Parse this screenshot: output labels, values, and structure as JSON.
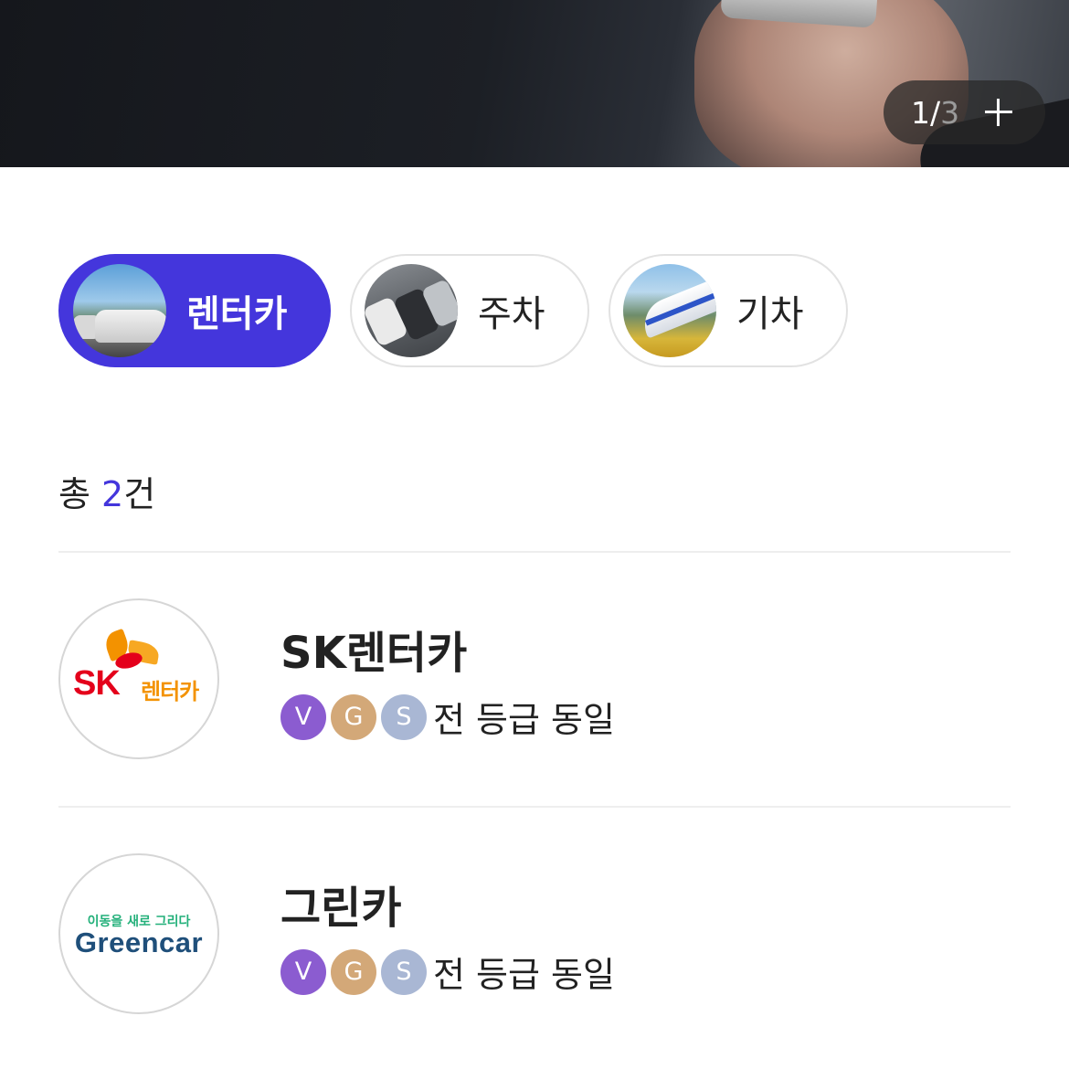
{
  "banner": {
    "pager": {
      "current": "1",
      "separator": "/",
      "total": "3"
    }
  },
  "categories": [
    {
      "label": "렌터카",
      "active": true
    },
    {
      "label": "주차",
      "active": false
    },
    {
      "label": "기차",
      "active": false
    }
  ],
  "summary": {
    "prefix": "총 ",
    "count": "2",
    "suffix": "건"
  },
  "grade_badges": [
    {
      "letter": "V",
      "color": "#8b5cd0"
    },
    {
      "letter": "G",
      "color": "#d3a878"
    },
    {
      "letter": "S",
      "color": "#a9b7d4"
    }
  ],
  "partners": [
    {
      "name": "SK렌터카",
      "logo": {
        "text": "SK",
        "sub": "렌터카"
      },
      "grade_note": "전 등급 동일"
    },
    {
      "name": "그린카",
      "logo": {
        "slogan": "이동을 새로 그리다",
        "wordmark": "Greencar"
      },
      "grade_note": "전 등급 동일"
    }
  ],
  "colors": {
    "accent": "#4436dc"
  }
}
